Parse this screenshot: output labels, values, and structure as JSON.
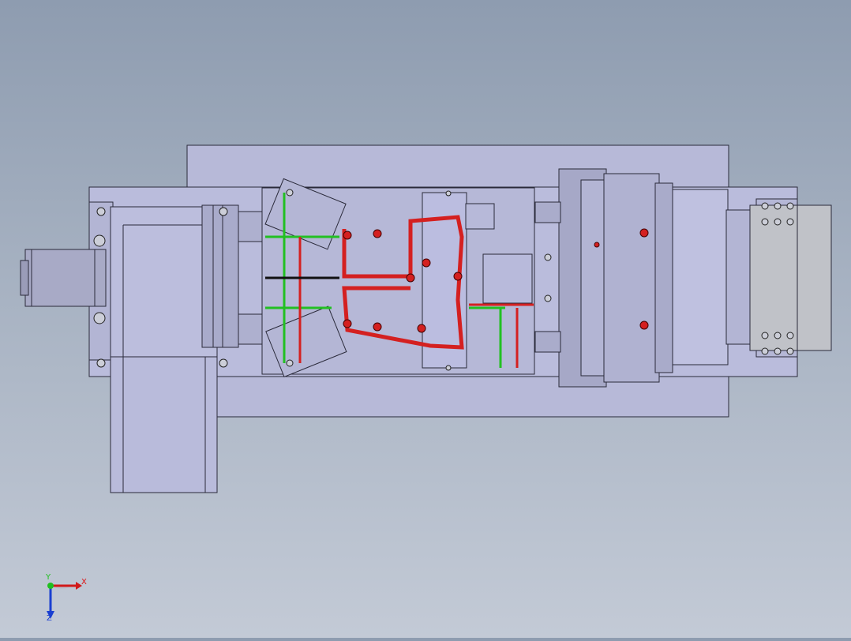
{
  "viewport": {
    "background_top": "#8e9cb0",
    "background_bottom": "#c3cad6",
    "part_fill": "#b9bbdb",
    "part_fill_dark": "#a7a9c9",
    "edge_color": "#2a2a3a",
    "highlight_red": "#d42020",
    "line_green": "#22c022"
  },
  "triad": {
    "x_label": "X",
    "y_label": "Y",
    "z_label": "Z",
    "x_color": "#d11a1a",
    "y_color": "#1fbf1f",
    "z_color": "#1a3fd1"
  }
}
